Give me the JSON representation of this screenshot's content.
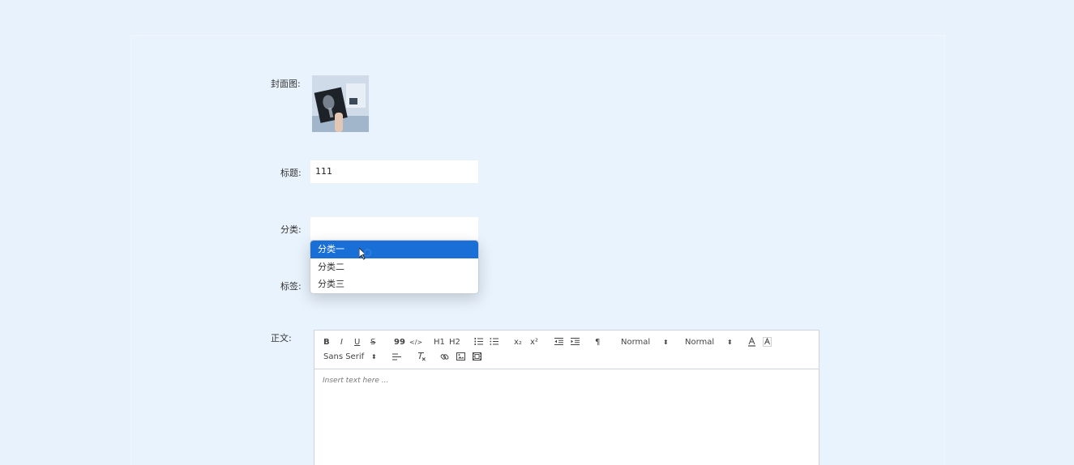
{
  "form": {
    "cover_label": "封面图:",
    "title_label": "标题:",
    "title_value": "111",
    "category_label": "分类:",
    "category_value": "",
    "tags_label": "标签:",
    "body_label": "正文:"
  },
  "category_dropdown": {
    "options": [
      "分类一",
      "分类二",
      "分类三"
    ],
    "highlighted": "分类一"
  },
  "editor": {
    "toolbar": {
      "bold": "B",
      "italic": "I",
      "underline": "U",
      "strike": "S",
      "blockquote": "99",
      "code": "</>",
      "h1": "H1",
      "h2": "H2",
      "subscript": "x₂",
      "superscript": "x²",
      "direction": "¶",
      "size_select": "Normal",
      "header_select": "Normal",
      "font_select": "Sans Serif"
    },
    "placeholder": "Insert text here ..."
  },
  "colors": {
    "page_bg": "#e8f2fd",
    "dropdown_selected": "#1a6fd6"
  }
}
